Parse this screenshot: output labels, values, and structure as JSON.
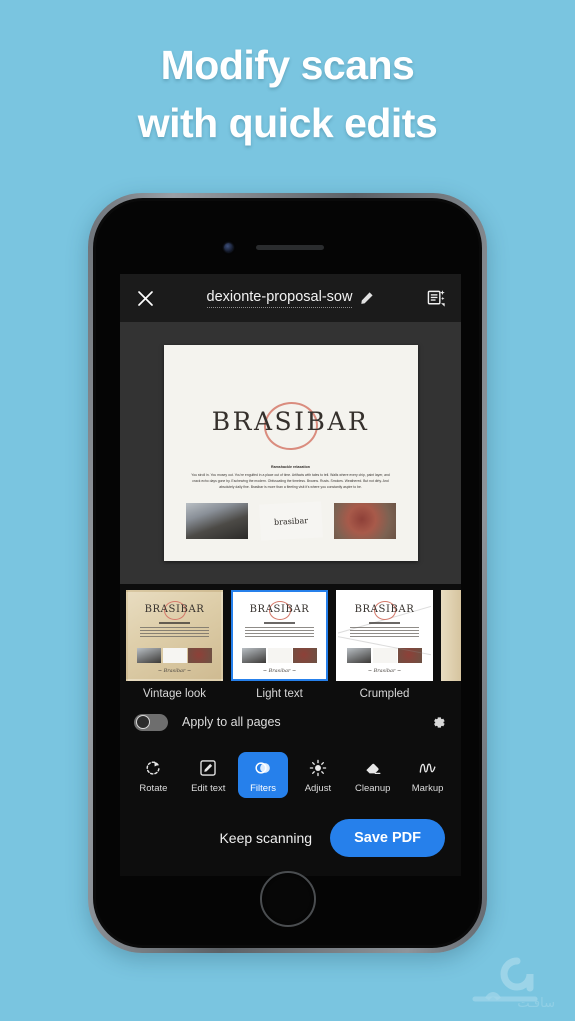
{
  "promo": {
    "headline_line1": "Modify scans",
    "headline_line2": "with quick edits",
    "background_color": "#7ac5e0"
  },
  "appbar": {
    "close_icon": "close-x-icon",
    "document_title": "dexionte-proposal-sow",
    "edit_title_icon": "pencil-icon",
    "enhance_icon": "document-sparkle-icon"
  },
  "preview": {
    "page_logo": "BRASIBAR",
    "page_heading": "Ramshackle relaxation",
    "page_body": "You stroll in. You mosey out. You're engulfed in a place out of time. Artifacts with tales to tell. Walls where every chip, paint layer, and crack echo days gone by. Eschewing the modern. Obfuscating the timeless. Browns. Rusts. Smokes. Weathered. But not dirty. And absolutely daily fine. Brasibar is more than a fleeting visit it's where you constantly aspire to be.",
    "image_caption": "brasibar"
  },
  "filters": {
    "items": [
      {
        "label": "",
        "style": "edge-left",
        "selected": false
      },
      {
        "label": "Vintage look",
        "style": "vintage",
        "selected": false
      },
      {
        "label": "Light text",
        "style": "light",
        "selected": true
      },
      {
        "label": "Crumpled",
        "style": "crumple",
        "selected": false
      },
      {
        "label": "",
        "style": "edge-right",
        "selected": false
      }
    ],
    "selected_color": "#2680eb"
  },
  "apply_all": {
    "label": "Apply to all pages",
    "toggle_state": "off",
    "settings_icon": "gear-icon"
  },
  "tools": [
    {
      "label": "Rotate",
      "icon": "rotate-icon",
      "active": false
    },
    {
      "label": "Edit text",
      "icon": "edit-text-icon",
      "active": false
    },
    {
      "label": "Filters",
      "icon": "filters-icon",
      "active": true
    },
    {
      "label": "Adjust",
      "icon": "brightness-icon",
      "active": false
    },
    {
      "label": "Cleanup",
      "icon": "eraser-icon",
      "active": false
    },
    {
      "label": "Markup",
      "icon": "markup-icon",
      "active": false
    }
  ],
  "actions": {
    "keep_scanning_label": "Keep scanning",
    "save_pdf_label": "Save PDF",
    "save_pdf_color": "#2680eb"
  },
  "watermark": {
    "text": "سافـت"
  }
}
